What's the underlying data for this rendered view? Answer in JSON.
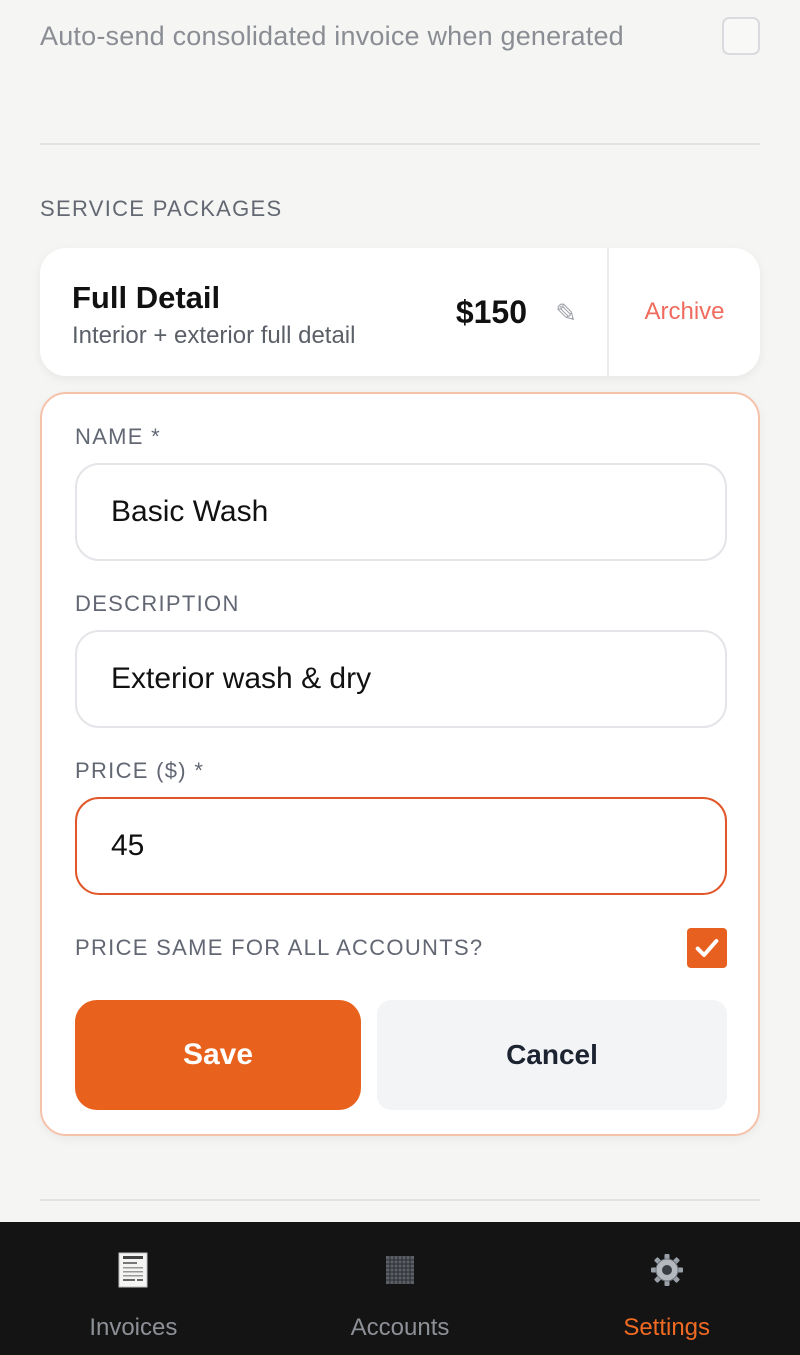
{
  "settings": {
    "auto_send_label": "Auto-send consolidated invoice when generated",
    "auto_send_checked": false
  },
  "service_packages": {
    "title": "SERVICE PACKAGES",
    "items": [
      {
        "name": "Full Detail",
        "description": "Interior + exterior full detail",
        "price": "$150",
        "edit_icon": "pencil-icon",
        "archive_label": "Archive"
      }
    ]
  },
  "edit_form": {
    "name_label": "NAME *",
    "name_value": "Basic Wash",
    "description_label": "DESCRIPTION",
    "description_value": "Exterior wash & dry",
    "price_label": "PRICE ($) *",
    "price_value": "45",
    "same_price_label": "PRICE SAME FOR ALL ACCOUNTS?",
    "same_price_checked": true,
    "save_label": "Save",
    "cancel_label": "Cancel"
  },
  "bottom_nav": {
    "items": [
      {
        "label": "Invoices",
        "icon": "receipt-icon",
        "active": false
      },
      {
        "label": "Accounts",
        "icon": "grid-icon",
        "active": false
      },
      {
        "label": "Settings",
        "icon": "gear-icon",
        "active": true
      }
    ]
  },
  "colors": {
    "accent": "#e8621e",
    "archive": "#ef6b5e",
    "nav_background": "#141414",
    "page_background": "#f5f5f3"
  }
}
